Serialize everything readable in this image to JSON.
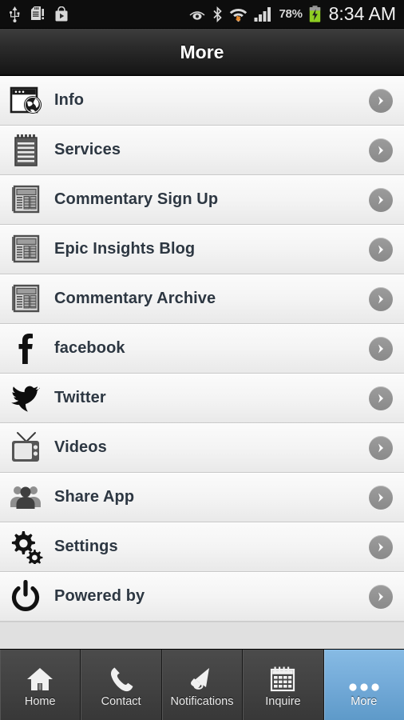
{
  "statusbar": {
    "left_icons": [
      "usb-icon",
      "sd-card-alert-icon",
      "play-store-icon"
    ],
    "right_icons": [
      "smart-stay-eye-icon",
      "bluetooth-icon",
      "wifi-icon",
      "signal-icon"
    ],
    "battery_percent": "78%",
    "battery_state": "charging",
    "clock": "8:34 AM"
  },
  "header": {
    "title": "More"
  },
  "list": {
    "items": [
      {
        "label": "Info",
        "icon": "browser-globe-icon"
      },
      {
        "label": "Services",
        "icon": "notepad-icon"
      },
      {
        "label": "Commentary Sign Up",
        "icon": "table-grid-icon"
      },
      {
        "label": "Epic Insights Blog",
        "icon": "table-grid-icon"
      },
      {
        "label": "Commentary Archive",
        "icon": "table-grid-icon"
      },
      {
        "label": "facebook",
        "icon": "facebook-icon"
      },
      {
        "label": "Twitter",
        "icon": "twitter-bird-icon"
      },
      {
        "label": "Videos",
        "icon": "television-icon"
      },
      {
        "label": "Share App",
        "icon": "people-group-icon"
      },
      {
        "label": "Settings",
        "icon": "gears-icon"
      },
      {
        "label": "Powered by",
        "icon": "power-button-icon"
      }
    ],
    "chevron_icon": "chevron-right-icon"
  },
  "tabbar": {
    "tabs": [
      {
        "label": "Home",
        "icon": "home-icon",
        "active": false
      },
      {
        "label": "Contact",
        "icon": "phone-icon",
        "active": false
      },
      {
        "label": "Notifications",
        "icon": "megaphone-icon",
        "active": false
      },
      {
        "label": "Inquire",
        "icon": "calendar-icon",
        "active": false
      },
      {
        "label": "More",
        "icon": "three-dots-icon",
        "active": true
      }
    ]
  },
  "colors": {
    "accent_blue": "#73aad8",
    "label_text": "#2d3742",
    "chevron_gray": "#919191",
    "battery_green": "#8ece22"
  }
}
